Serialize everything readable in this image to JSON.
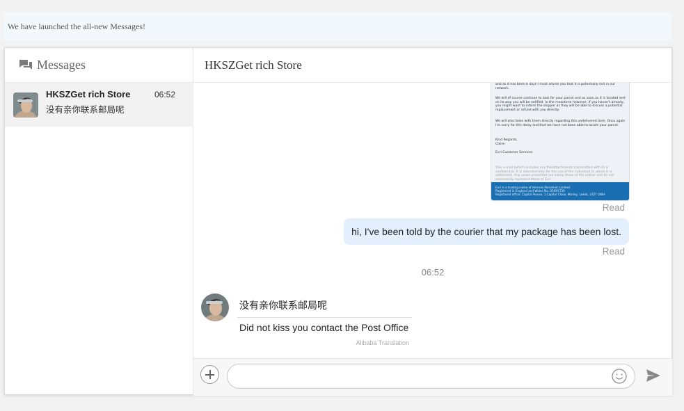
{
  "banner": {
    "text": "We have launched the all-new Messages!"
  },
  "sidebar": {
    "title": "Messages",
    "conversations": [
      {
        "name": "HKSZGet rich Store",
        "time": "06:52",
        "preview": "没有亲你联系邮局呢"
      }
    ]
  },
  "chat": {
    "title": "HKSZGet rich Store",
    "email_image": {
      "lines": [
        "and as it has been 6 days I must advise you that it is potentially lost in our network.",
        "We will of course continue to look for your parcel and as soon as it is located and on its way you will be notified. In the meantime however, if you haven't already, you might want to inform the shipper as they will be able to discuss a potential replacement or refund with you directly.",
        "We will also liaise with them directly regarding this undelivered item. Once again I'm sorry for this delay and that we have not been able to locate your parcel.",
        "Kind Regards,",
        "Claire",
        "Evri Customer Services"
      ],
      "disclaimer": "This e-mail (which includes any file/attachments transmitted with it) is confidential. It is intended only for the use of the individual to whom it is addressed. Any views presented are solely those of the author and do not necessarily represent those of Evri.",
      "footer": [
        "Evri is a trading name of Hermes Parcelnet Limited.",
        "Registered in England and Wales No. 05691730",
        "Registered office: Capitol House, 1 Capitol Close, Morley, Leeds, LS27 0WH"
      ]
    },
    "read_label_1": "Read",
    "sent_message": "hi, I've been told by the courier that my package has been lost.",
    "read_label_2": "Read",
    "time_separator": "06:52",
    "received_message": {
      "original": "没有亲你联系邮局呢",
      "translated": "Did not kiss you contact the Post Office",
      "attribution": "Alibaba Translation"
    },
    "composer": {
      "placeholder": "",
      "value": ""
    }
  },
  "colors": {
    "accent_bubble": "#e3effd",
    "banner_bg": "#f3f8fd",
    "email_footer": "#1a6fb3",
    "selected_conv_bg": "#f2f2f2"
  },
  "icons": {
    "sidebar_header": "chat-bubbles-icon",
    "add": "plus-circle-icon",
    "emoji": "smiley-icon",
    "send": "paper-plane-icon"
  }
}
